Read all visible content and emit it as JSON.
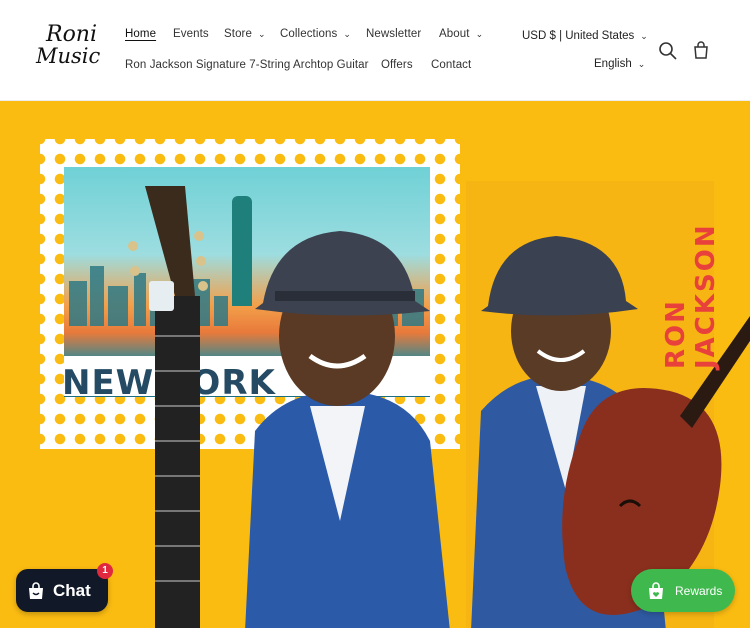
{
  "brand": {
    "logo_line1": "Roni",
    "logo_line2": "Music"
  },
  "nav": {
    "row1": [
      {
        "label": "Home",
        "active": true
      },
      {
        "label": "Events"
      },
      {
        "label": "Store",
        "has_dropdown": true
      },
      {
        "label": "Collections",
        "has_dropdown": true
      },
      {
        "label": "Newsletter"
      },
      {
        "label": "About",
        "has_dropdown": true
      }
    ],
    "row2": [
      {
        "label": "Ron Jackson Signature 7-String Archtop Guitar"
      },
      {
        "label": "Offers"
      },
      {
        "label": "Contact"
      }
    ]
  },
  "utility": {
    "currency": "USD $ | United States",
    "language": "English",
    "search_icon": "search-icon",
    "cart_icon": "cart-icon"
  },
  "hero": {
    "background_color": "#fbbc12",
    "stamp_text": "NEW YORK",
    "artist_name_line1": "RON",
    "artist_name_line2": "JACKSON"
  },
  "chat": {
    "label": "Chat",
    "badge_count": "1"
  },
  "rewards": {
    "label": "Rewards"
  },
  "colors": {
    "accent_green": "#3fb94d",
    "chat_dark": "#111827",
    "badge_red": "#e0293e",
    "name_red": "#e8413c"
  }
}
